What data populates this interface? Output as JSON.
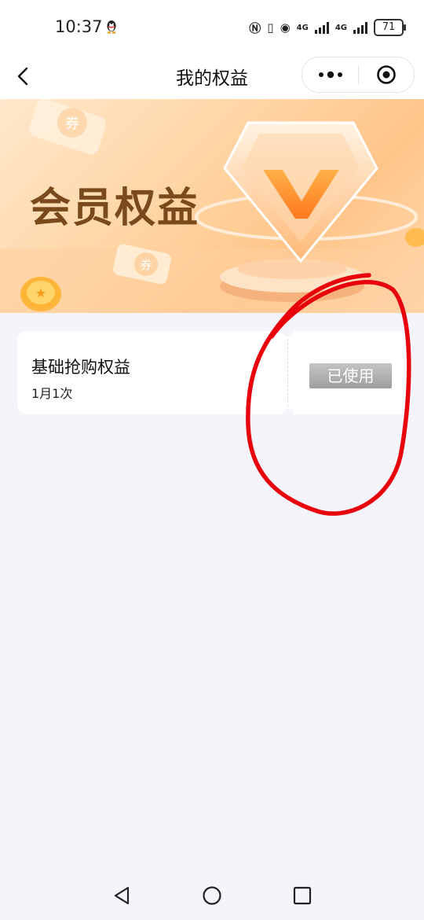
{
  "status_bar": {
    "time": "10:37",
    "net_a": "4G",
    "net_b": "4G",
    "battery": "71"
  },
  "nav": {
    "title": "我的权益"
  },
  "banner": {
    "title": "会员权益",
    "coupon_glyph": "券"
  },
  "rights": [
    {
      "name": "基础抢购权益",
      "limit": "1月1次",
      "status": "已使用"
    }
  ],
  "colors": {
    "page_bg": "#f5f4fa",
    "banner_text": "#7a4a1c",
    "annotation": "#e8000b"
  }
}
